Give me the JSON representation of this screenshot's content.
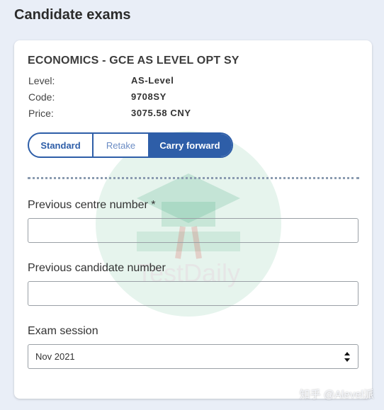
{
  "page": {
    "title": "Candidate exams"
  },
  "exam": {
    "title": "ECONOMICS - GCE AS LEVEL OPT SY",
    "level_label": "Level:",
    "level_value": "AS-Level",
    "code_label": "Code:",
    "code_value": "9708SY",
    "price_label": "Price:",
    "price_value": "3075.58 CNY"
  },
  "entry_type": {
    "options": [
      "Standard",
      "Retake",
      "Carry forward"
    ],
    "selected": "Carry forward"
  },
  "form": {
    "prev_centre_label": "Previous centre number *",
    "prev_centre_value": "",
    "prev_candidate_label": "Previous candidate number",
    "prev_candidate_value": "",
    "exam_session_label": "Exam session",
    "exam_session_value": "Nov 2021"
  },
  "watermarks": {
    "center_text": "TestDaily",
    "corner_text": "知乎 @Alevel派"
  },
  "colors": {
    "accent": "#2e5ea8",
    "watermark_green": "#4cae82",
    "watermark_red": "#d9534f"
  }
}
